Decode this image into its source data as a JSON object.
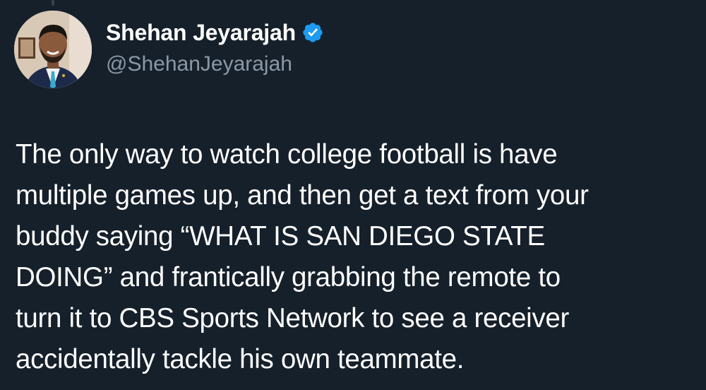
{
  "tweet": {
    "author": {
      "display_name": "Shehan Jeyarajah",
      "handle": "@ShehanJeyarajah",
      "verified": true,
      "avatar_icon": "profile-photo-icon"
    },
    "text_lines": [
      "The only way to watch college football is have",
      "multiple games up, and then get a text from your",
      "buddy saying “WHAT IS SAN DIEGO STATE",
      "DOING” and frantically grabbing the remote to",
      "turn it to CBS Sports Network to see a receiver",
      "accidentally tackle his own teammate."
    ]
  },
  "colors": {
    "background": "#15202b",
    "text": "#ffffff",
    "secondary_text": "#8b98a5",
    "verified_blue": "#1d9bf0"
  }
}
